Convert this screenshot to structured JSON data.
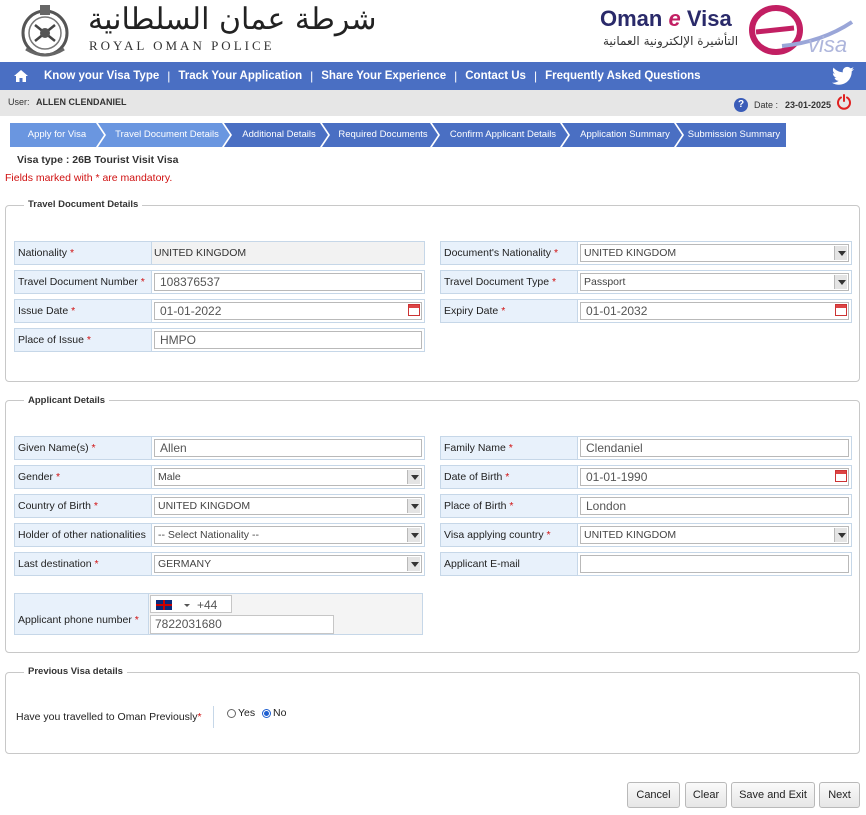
{
  "header": {
    "police_arabic": "شرطة عمان السلطانية",
    "police_english": "ROYAL OMAN POLICE",
    "evisa_title_a": "Oman ",
    "evisa_title_e": "e",
    "evisa_title_b": " Visa",
    "evisa_arabic": "التأشيرة الإلكترونية العمانية",
    "logo_text": "visa"
  },
  "nav": {
    "items": [
      "Know your Visa Type",
      "Track Your Application",
      "Share Your Experience",
      "Contact Us",
      "Frequently Asked Questions"
    ],
    "separator": "|"
  },
  "userbar": {
    "user_label": "User:",
    "user_name": "ALLEN  CLENDANIEL",
    "help": "?",
    "date_label": "Date :",
    "date_value": "23-01-2025"
  },
  "steps": [
    "Apply for Visa",
    "Travel Document Details",
    "Additional Details",
    "Required Documents",
    "Confirm Applicant Details",
    "Application Summary",
    "Submission Summary"
  ],
  "visa_type": "Visa type  : 26B Tourist Visit Visa",
  "mandatory_note": "Fields marked with * are mandatory.",
  "travel_doc": {
    "legend": "Travel Document Details",
    "nationality_label": "Nationality",
    "nationality_value": "UNITED KINGDOM",
    "doc_nationality_label": "Document's Nationality",
    "doc_nationality_value": "UNITED KINGDOM",
    "doc_number_label": "Travel Document Number",
    "doc_number_value": "108376537",
    "doc_type_label": "Travel Document Type",
    "doc_type_value": "Passport",
    "issue_date_label": "Issue Date",
    "issue_date_value": "01-01-2022",
    "expiry_date_label": "Expiry Date",
    "expiry_date_value": "01-01-2032",
    "place_issue_label": "Place of Issue",
    "place_issue_value": "HMPO"
  },
  "applicant": {
    "legend": "Applicant Details",
    "given_name_label": "Given Name(s)",
    "given_name_value": "Allen",
    "family_name_label": "Family Name",
    "family_name_value": "Clendaniel",
    "gender_label": "Gender",
    "gender_value": "Male",
    "dob_label": "Date of Birth",
    "dob_value": "01-01-1990",
    "country_birth_label": "Country of Birth",
    "country_birth_value": "UNITED KINGDOM",
    "place_birth_label": "Place of Birth",
    "place_birth_value": "London",
    "other_nat_label": "Holder of other nationalities",
    "other_nat_value": "-- Select Nationality --",
    "visa_country_label": "Visa applying country",
    "visa_country_value": "UNITED KINGDOM",
    "last_dest_label": "Last destination",
    "last_dest_value": "GERMANY",
    "email_label": "Applicant E-mail",
    "email_value": "",
    "phone_label": "Applicant phone number",
    "phone_cc": "+44",
    "phone_value": "7822031680"
  },
  "prev_visa": {
    "legend": "Previous Visa details",
    "question": "Have you travelled to Oman Previously",
    "yes": "Yes",
    "no": "No",
    "selected": "No"
  },
  "buttons": {
    "cancel": "Cancel",
    "clear": "Clear",
    "save_exit": "Save and Exit",
    "next": "Next"
  },
  "req_mark": "*",
  "colors": {
    "nav": "#4a6fc3",
    "step_active": "#6a96e0",
    "required": "#d01010",
    "label_bg": "#e8f1fb"
  }
}
